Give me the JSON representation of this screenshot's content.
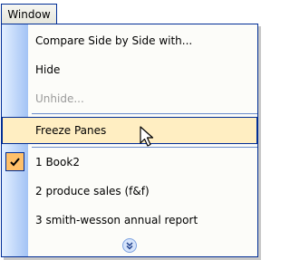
{
  "menubar": {
    "window_label": "Window"
  },
  "menu": {
    "items": [
      {
        "label": "Compare Side by Side with...",
        "state": "enabled"
      },
      {
        "label": "Hide",
        "state": "enabled"
      },
      {
        "label": "Unhide...",
        "state": "disabled"
      },
      {
        "label": "Freeze Panes",
        "state": "hover"
      },
      {
        "label": "1 Book2",
        "state": "checked"
      },
      {
        "label": "2 produce sales (f&f)",
        "state": "enabled"
      },
      {
        "label": "3 smith-wesson annual report",
        "state": "enabled"
      }
    ],
    "expand_icon": "double-chevron-down-icon"
  },
  "colors": {
    "border": "#002d96",
    "hover_bg": "#ffeec2",
    "check_bg": "#ffc069",
    "gutter_start": "#e3efff",
    "gutter_end": "#a3c3f5"
  }
}
